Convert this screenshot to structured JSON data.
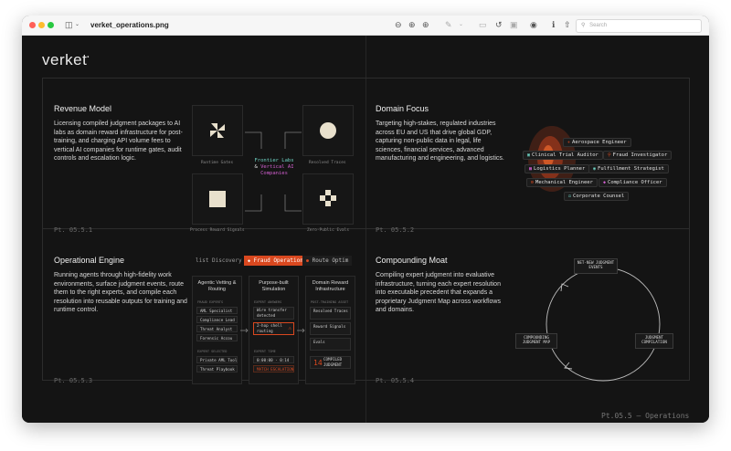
{
  "window": {
    "title": "verket_operations.png",
    "search_placeholder": "Search"
  },
  "colors": {
    "accent_orange": "#d9481f",
    "cyan": "#6fd3c4",
    "magenta": "#d25fd0",
    "line": "#2c2c2c"
  },
  "logo": "verket",
  "footer": "Pt.05.5 — Operations",
  "panels": {
    "revenue": {
      "title": "Revenue Model",
      "body": "Licensing compiled judgment packages to AI labs as domain reward infrastructure for post-training, and charging API volume fees to vertical AI companies for runtime gates, audit controls and escalation logic.",
      "num": "Pt. 05.5.1",
      "tiles": [
        "Runtime Gates",
        "Resolved Traces",
        "Process Reward Signals",
        "Zero-Public Evals"
      ],
      "center": {
        "line1": "Frontier Labs",
        "amp": "&",
        "line2": "Vertical AI",
        "line3": "Companies"
      }
    },
    "domain": {
      "title": "Domain Focus",
      "body": "Targeting high-stakes, regulated industries across EU and US that drive global GDP, capturing non-public data in legal, life sciences, financial services, advanced manufacturing and engineering, and logistics.",
      "num": "Pt. 05.5.2",
      "chips": [
        {
          "label": "Aerospace Engineer",
          "icon": "aircraft-icon"
        },
        {
          "label": "Clinical Trial Auditor",
          "icon": "clipboard-icon"
        },
        {
          "label": "Fraud Investigator",
          "icon": "magnifier-icon"
        },
        {
          "label": "Logistics Planner",
          "icon": "truck-icon"
        },
        {
          "label": "Fulfillment Strategist",
          "icon": "box-icon"
        },
        {
          "label": "Mechanical Engineer",
          "icon": "gear-icon"
        },
        {
          "label": "Compliance Officer",
          "icon": "shield-icon"
        },
        {
          "label": "Corporate Counsel",
          "icon": "scale-icon"
        }
      ]
    },
    "engine": {
      "title": "Operational Engine",
      "body": "Running agents through high-fidelity work environments, surface judgment events, route them to the right experts, and compile each resolution into reusable outputs for training and runtime control.",
      "num": "Pt. 05.5.3",
      "tabs": [
        "list Discovery",
        "Fraud Operation",
        "Route Optim"
      ],
      "columns": [
        {
          "title": "Agentic Vetting & Routing",
          "sections": [
            {
              "label": "FRAUD EXPERTS",
              "items": [
                "AML Specialist",
                "Compliance Lead",
                "Threat Analyst",
                "Forensic Accou"
              ]
            },
            {
              "label": "EXPERT SELECTED",
              "items": [
                "Private AML Tool",
                "Threat Playbook"
              ]
            }
          ]
        },
        {
          "title": "Purpose-built Simulation",
          "sections": [
            {
              "label": "EXPERT ANSWERS",
              "items": [
                "Wire transfer detected",
                "2-hop shell routing"
              ]
            },
            {
              "label": "EXPERT TIME",
              "items": [
                "0:00:00 · 0:14",
                "MATCH ESCALATION"
              ]
            }
          ]
        },
        {
          "title": "Domain Reward Infrastructure",
          "sections": [
            {
              "label": "POST-TRAINING ASSET",
              "items": [
                "Resolved Traces",
                "Reward Signals",
                "Evals"
              ]
            },
            {
              "label": "",
              "items": [
                "COMPILED JUDGMENT"
              ]
            }
          ],
          "stat": "14"
        }
      ]
    },
    "moat": {
      "title": "Compounding Moat",
      "body": "Compiling expert judgment into evaluative infrastructure, turning each expert resolution into executable precedent that expands a proprietary Judgment Map across workflows and domains.",
      "num": "Pt. 05.5.4",
      "nodes": [
        "NET-NEW JUDGMENT EVENTS",
        "JUDGMENT COMPILATION",
        "COMPOUNDING JUDGMENT MAP"
      ]
    }
  }
}
